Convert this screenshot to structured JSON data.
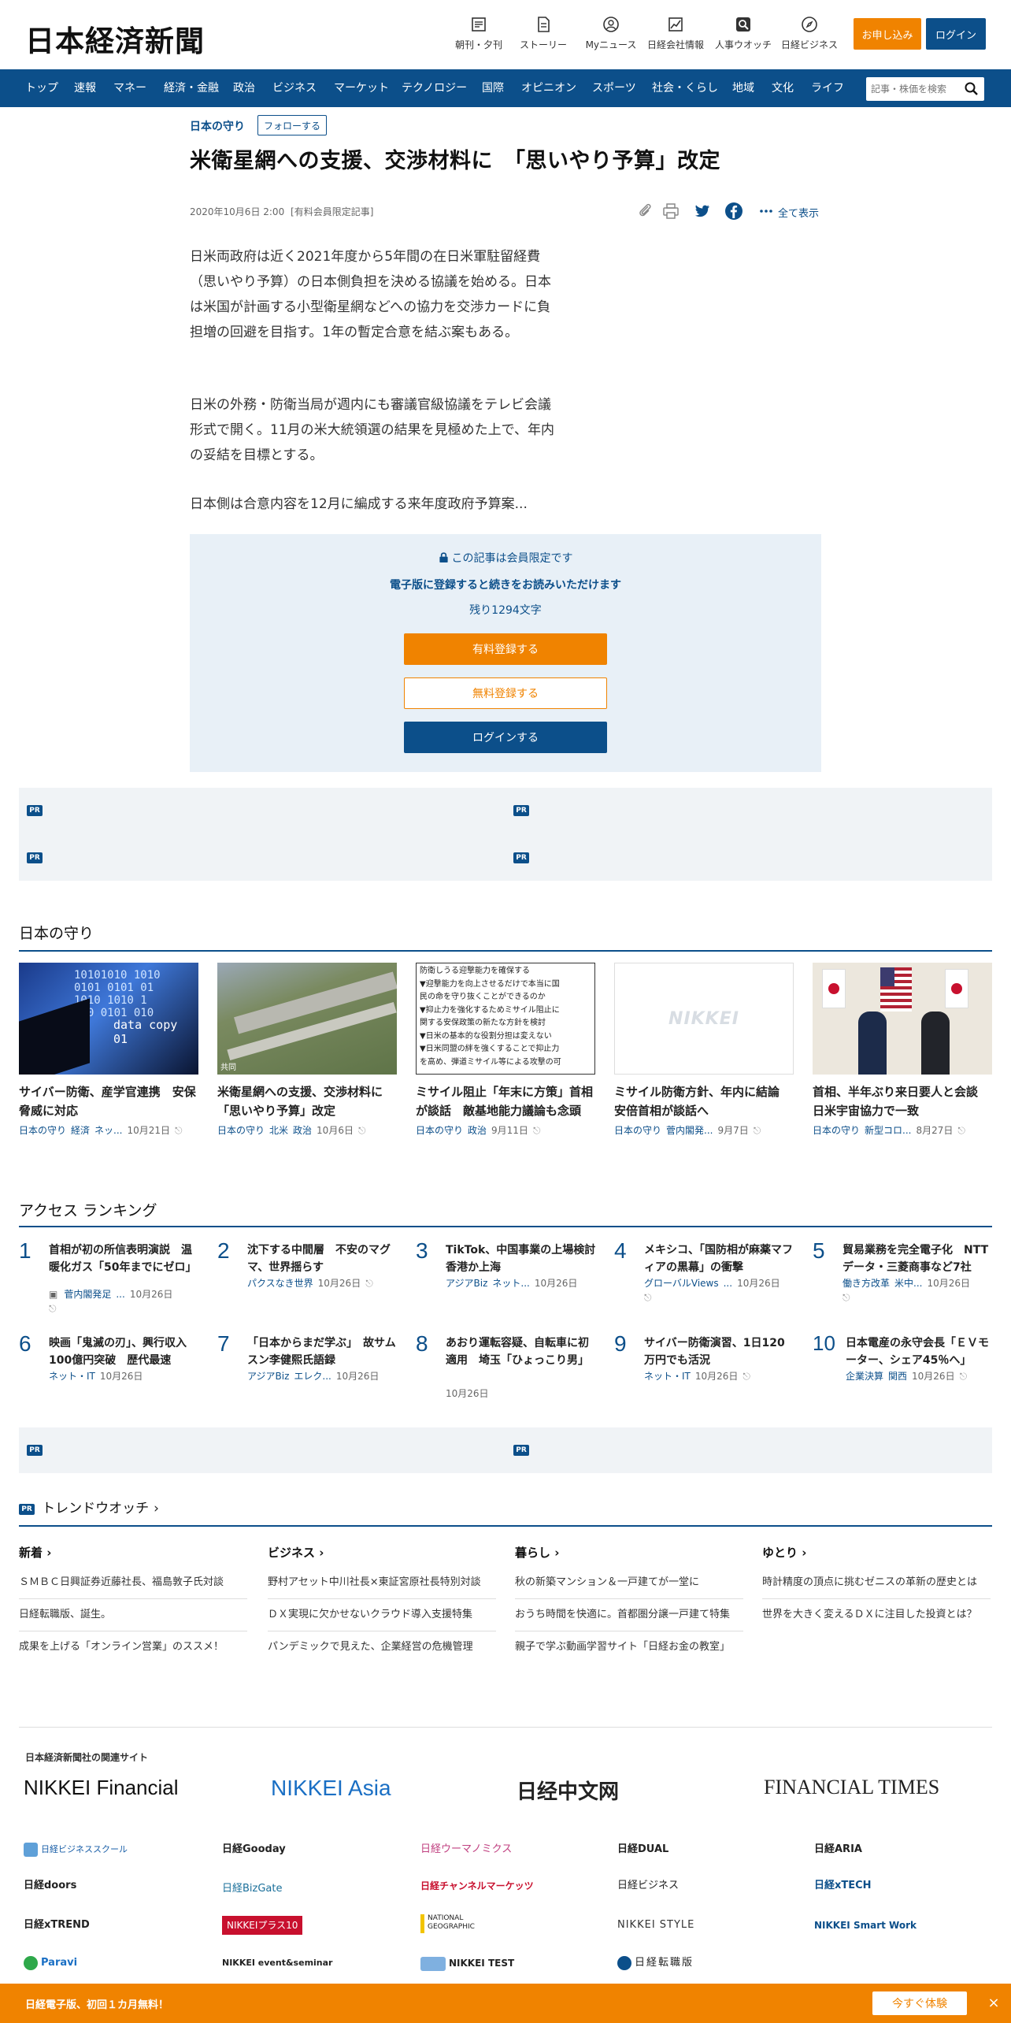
{
  "header": {
    "logo": "日本経済新聞",
    "icons": [
      {
        "label": "朝刊・夕刊",
        "icon": "newspaper-icon"
      },
      {
        "label": "ストーリー",
        "icon": "story-icon"
      },
      {
        "label": "Myニュース",
        "icon": "user-icon"
      },
      {
        "label": "日経会社情報",
        "icon": "chart-icon"
      },
      {
        "label": "人事ウオッチ",
        "icon": "search-person-icon"
      },
      {
        "label": "日経ビジネス",
        "icon": "compass-icon"
      }
    ],
    "apply_label": "お申し込み",
    "login_label": "ログイン",
    "apply_color": "#f08300",
    "brand_color": "#0c4f8a"
  },
  "nav": {
    "items": [
      "トップ",
      "速報",
      "マネー",
      "経済・金融",
      "政治",
      "ビジネス",
      "マーケット",
      "テクノロジー",
      "国際",
      "オピニオン",
      "スポーツ",
      "社会・くらし",
      "地域",
      "文化",
      "ライフ"
    ],
    "search_placeholder": "記事・株価を検索"
  },
  "article": {
    "section": "日本の守り",
    "follow_label": "フォローする",
    "title": "米衛星網への支援、交渉材料に　「思いやり予算」改定",
    "date": "2020年10月6日 2:00",
    "member_note": "[有料会員限定記事]",
    "share_all": "全て表示",
    "paragraphs": [
      "日米両政府は近く2021年度から5年間の在日米軍駐留経費（思いやり予算）の日本側負担を決める協議を始める。日本は米国が計画する小型衛星網などへの協力を交渉カードに負担増の回避を目指す。1年の暫定合意を結ぶ案もある。",
      "日米の外務・防衛当局が週内にも審議官級協議をテレビ会議形式で開く。11月の米大統領選の結果を見極めた上で、年内の妥結を目標とする。",
      "日本側は合意内容を12月に編成する来年度政府予算案..."
    ]
  },
  "paywall": {
    "lock_text": "この記事は会員限定です",
    "register_text": "電子版に登録すると続きをお読みいただけます",
    "remaining": "残り1294文字",
    "paid_label": "有料登録する",
    "free_label": "無料登録する",
    "login_label": "ログインする"
  },
  "pr_tag": "PR",
  "series": {
    "title": "日本の守り",
    "cards": [
      {
        "title": "サイバー防衛、産学官連携　安保脅威に対応",
        "tags": [
          "日本の守り",
          "経済",
          "ネッ..."
        ],
        "date": "10月21日",
        "thumb_text": "data copy 01"
      },
      {
        "title": "米衛星網への支援、交渉材料に　「思いやり予算」改定",
        "tags": [
          "日本の守り",
          "北米",
          "政治"
        ],
        "date": "10月6日",
        "thumb_text": "共同"
      },
      {
        "title": "ミサイル阻止「年末に方策」首相が談話　敵基地能力議論も念頭",
        "tags": [
          "日本の守り",
          "政治"
        ],
        "date": "9月11日",
        "thumb_lines": [
          "防衛しうる迎撃能力を確保する",
          "▼迎撃能力を向上させるだけで本当に国",
          "民の命を守り抜くことができるのか",
          "▼抑止力を強化するためミサイル阻止に",
          "関する安保政策の新たな方針を検討",
          "▼日米の基本的な役割分担は変えない",
          "▼日米同盟の絆を強くすることで抑止力",
          "を高め、弾道ミサイル等による攻撃の可"
        ]
      },
      {
        "title": "ミサイル防衛方針、年内に結論　安倍首相が談話へ",
        "tags": [
          "日本の守り",
          "菅内閣発..."
        ],
        "date": "9月7日",
        "thumb_text": "NIKKEI"
      },
      {
        "title": "首相、半年ぶり来日要人と会談　日米宇宙協力で一致",
        "tags": [
          "日本の守り",
          "新型コロ..."
        ],
        "date": "8月27日"
      }
    ]
  },
  "ranking": {
    "title": "アクセス ランキング",
    "items": [
      {
        "num": "1",
        "title": "首相が初の所信表明演説　温暖化ガス「50年までにゼロ」",
        "tags": [
          "菅内閣発足",
          "..."
        ],
        "date": "10月26日"
      },
      {
        "num": "2",
        "title": "沈下する中間層　不安のマグマ、世界揺らす",
        "tags": [
          "パクスなき世界"
        ],
        "date": "10月26日"
      },
      {
        "num": "3",
        "title": "TikTok、中国事業の上場検討　香港か上海",
        "tags": [
          "アジアBiz",
          "ネット..."
        ],
        "date": "10月26日"
      },
      {
        "num": "4",
        "title": "メキシコ、「国防相が麻薬マフィアの黒幕」の衝撃",
        "tags": [
          "グローバルViews",
          "..."
        ],
        "date": "10月26日"
      },
      {
        "num": "5",
        "title": "貿易業務を完全電子化　NTTデータ・三菱商事など7社",
        "tags": [
          "働き方改革",
          "米中..."
        ],
        "date": "10月26日"
      },
      {
        "num": "6",
        "title": "映画「鬼滅の刃」、興行収入100億円突破　歴代最速",
        "tags": [
          "ネット・IT"
        ],
        "date": "10月26日"
      },
      {
        "num": "7",
        "title": "「日本からまだ学ぶ」　故サムスン李健熙氏語録",
        "tags": [
          "アジアBiz",
          "エレク..."
        ],
        "date": "10月26日"
      },
      {
        "num": "8",
        "title": "あおり運転容疑、自転車に初適用　埼玉「ひょっこり男」",
        "tags": [],
        "date": "10月26日"
      },
      {
        "num": "9",
        "title": "サイバー防衛演習、1日120万円でも活況",
        "tags": [
          "ネット・IT"
        ],
        "date": "10月26日"
      },
      {
        "num": "10",
        "title": "日本電産の永守会長「ＥＶモーター、シェア45％へ」",
        "tags": [
          "企業決算",
          "関西"
        ],
        "date": "10月26日"
      }
    ]
  },
  "trend": {
    "title": "トレンドウオッチ",
    "columns": [
      {
        "head": "新着",
        "items": [
          "ＳＭＢＣ日興証券近藤社長、福島敦子氏対談",
          "日経転職版、誕生。",
          "成果を上げる「オンライン営業」のススメ！"
        ]
      },
      {
        "head": "ビジネス",
        "items": [
          "野村アセット中川社長×東証宮原社長特別対談",
          "ＤＸ実現に欠かせないクラウド導入支援特集",
          "パンデミックで見えた、企業経営の危機管理"
        ]
      },
      {
        "head": "暮らし",
        "items": [
          "秋の新築マンション＆一戸建てが一堂に",
          "おうち時間を快適に。首都圏分譲一戸建て特集",
          "親子で学ぶ動画学習サイト「日経お金の教室」"
        ]
      },
      {
        "head": "ゆとり",
        "items": [
          "時計精度の頂点に挑むゼニスの革新の歴史とは",
          "世界を大きく変えるＤＸに注目した投資とは？"
        ]
      }
    ]
  },
  "related": {
    "title": "日本経済新聞社の関連サイト",
    "big": [
      "NIKKEI Financial",
      "NIKKEI Asia",
      "日经中文网",
      "FINANCIAL TIMES"
    ],
    "small": [
      "日経ビジネススクール",
      "日経Gooday",
      "日経ウーマノミクス",
      "日経DUAL",
      "日経ARIA",
      "日経doors",
      "日経BizGate",
      "日経チャンネルマーケッツ",
      "日経ビジネス",
      "日経xTECH",
      "日経xTREND",
      "NIKKEIプラス10",
      "NATIONAL GEOGRAPHIC",
      "NIKKEI STYLE",
      "NIKKEI Smart Work",
      "Paravi",
      "NIKKEI event&seminar",
      "NIKKEI TEST",
      "日経転職版"
    ]
  },
  "bottom_bar": {
    "text": "日経電子版、初回１カ月無料！",
    "cta": "今すぐ体験",
    "close": "×"
  }
}
